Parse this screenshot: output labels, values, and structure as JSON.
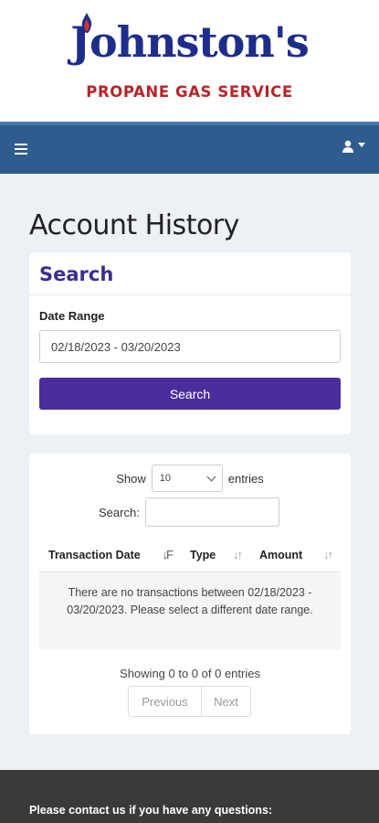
{
  "brand": {
    "name": "Johnston's",
    "tagline": "PROPANE GAS SERVICE",
    "primary_color": "#1f2d8a",
    "accent_color": "#b8232a"
  },
  "navbar": {
    "background": "#2e5c8e",
    "menu_icon": "hamburger-icon",
    "user_icon": "user-icon"
  },
  "page": {
    "title": "Account History"
  },
  "search_panel": {
    "title": "Search",
    "date_range_label": "Date Range",
    "date_range_value": "02/18/2023 - 03/20/2023",
    "search_button": "Search",
    "button_color": "#4a2f9c"
  },
  "table": {
    "show_label": "Show",
    "entries_value": "10",
    "entries_label": "entries",
    "search_label": "Search:",
    "columns": [
      "Transaction Date",
      "Type",
      "Amount"
    ],
    "empty_message": "There are no transactions between 02/18/2023 - 03/20/2023. Please select a different date range.",
    "info": "Showing 0 to 0 of 0 entries",
    "previous": "Previous",
    "next": "Next"
  },
  "footer": {
    "text": "Please contact us if you have any questions:"
  }
}
